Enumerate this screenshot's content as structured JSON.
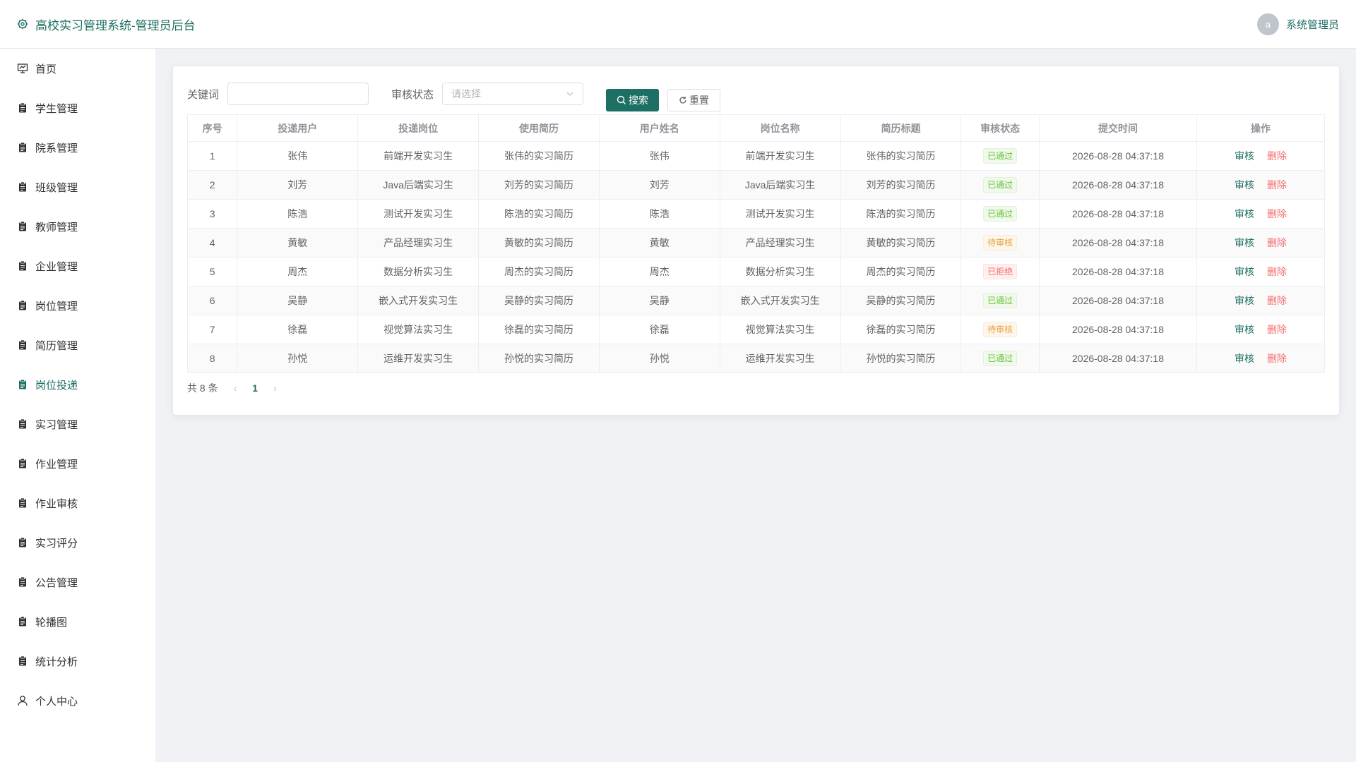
{
  "header": {
    "title": "高校实习管理系统-管理员后台",
    "avatar_text": "a",
    "username": "系统管理员"
  },
  "sidebar": {
    "items": [
      {
        "label": "首页",
        "icon": "dashboard-icon",
        "active": false
      },
      {
        "label": "学生管理",
        "icon": "clipboard-icon",
        "active": false
      },
      {
        "label": "院系管理",
        "icon": "clipboard-icon",
        "active": false
      },
      {
        "label": "班级管理",
        "icon": "clipboard-icon",
        "active": false
      },
      {
        "label": "教师管理",
        "icon": "clipboard-icon",
        "active": false
      },
      {
        "label": "企业管理",
        "icon": "clipboard-icon",
        "active": false
      },
      {
        "label": "岗位管理",
        "icon": "clipboard-icon",
        "active": false
      },
      {
        "label": "简历管理",
        "icon": "clipboard-icon",
        "active": false
      },
      {
        "label": "岗位投递",
        "icon": "clipboard-icon",
        "active": true
      },
      {
        "label": "实习管理",
        "icon": "clipboard-icon",
        "active": false
      },
      {
        "label": "作业管理",
        "icon": "clipboard-icon",
        "active": false
      },
      {
        "label": "作业审核",
        "icon": "clipboard-icon",
        "active": false
      },
      {
        "label": "实习评分",
        "icon": "clipboard-icon",
        "active": false
      },
      {
        "label": "公告管理",
        "icon": "clipboard-icon",
        "active": false
      },
      {
        "label": "轮播图",
        "icon": "clipboard-icon",
        "active": false
      },
      {
        "label": "统计分析",
        "icon": "clipboard-icon",
        "active": false
      },
      {
        "label": "个人中心",
        "icon": "user-icon",
        "active": false
      }
    ]
  },
  "filters": {
    "keyword_label": "关键词",
    "keyword_value": "",
    "status_label": "审核状态",
    "status_placeholder": "请选择",
    "search_label": "搜索",
    "reset_label": "重置"
  },
  "table": {
    "columns": [
      "序号",
      "投递用户",
      "投递岗位",
      "使用简历",
      "用户姓名",
      "岗位名称",
      "简历标题",
      "审核状态",
      "提交时间",
      "操作"
    ],
    "rows": [
      {
        "no": "1",
        "user": "张伟",
        "job": "前端开发实习生",
        "resume": "张伟的实习简历",
        "name": "张伟",
        "position": "前端开发实习生",
        "title": "张伟的实习简历",
        "status": "已通过",
        "status_type": "success",
        "time": "2026-08-28 04:37:18"
      },
      {
        "no": "2",
        "user": "刘芳",
        "job": "Java后端实习生",
        "resume": "刘芳的实习简历",
        "name": "刘芳",
        "position": "Java后端实习生",
        "title": "刘芳的实习简历",
        "status": "已通过",
        "status_type": "success",
        "time": "2026-08-28 04:37:18"
      },
      {
        "no": "3",
        "user": "陈浩",
        "job": "测试开发实习生",
        "resume": "陈浩的实习简历",
        "name": "陈浩",
        "position": "测试开发实习生",
        "title": "陈浩的实习简历",
        "status": "已通过",
        "status_type": "success",
        "time": "2026-08-28 04:37:18"
      },
      {
        "no": "4",
        "user": "黄敏",
        "job": "产品经理实习生",
        "resume": "黄敏的实习简历",
        "name": "黄敏",
        "position": "产品经理实习生",
        "title": "黄敏的实习简历",
        "status": "待审核",
        "status_type": "warning",
        "time": "2026-08-28 04:37:18"
      },
      {
        "no": "5",
        "user": "周杰",
        "job": "数据分析实习生",
        "resume": "周杰的实习简历",
        "name": "周杰",
        "position": "数据分析实习生",
        "title": "周杰的实习简历",
        "status": "已拒绝",
        "status_type": "danger",
        "time": "2026-08-28 04:37:18"
      },
      {
        "no": "6",
        "user": "吴静",
        "job": "嵌入式开发实习生",
        "resume": "吴静的实习简历",
        "name": "吴静",
        "position": "嵌入式开发实习生",
        "title": "吴静的实习简历",
        "status": "已通过",
        "status_type": "success",
        "time": "2026-08-28 04:37:18"
      },
      {
        "no": "7",
        "user": "徐磊",
        "job": "视觉算法实习生",
        "resume": "徐磊的实习简历",
        "name": "徐磊",
        "position": "视觉算法实习生",
        "title": "徐磊的实习简历",
        "status": "待审核",
        "status_type": "warning",
        "time": "2026-08-28 04:37:18"
      },
      {
        "no": "8",
        "user": "孙悦",
        "job": "运维开发实习生",
        "resume": "孙悦的实习简历",
        "name": "孙悦",
        "position": "运维开发实习生",
        "title": "孙悦的实习简历",
        "status": "已通过",
        "status_type": "success",
        "time": "2026-08-28 04:37:18"
      }
    ],
    "actions": {
      "audit": "审核",
      "delete": "删除"
    }
  },
  "pagination": {
    "total_text": "共 8 条",
    "current_page": "1"
  },
  "colors": {
    "accent": "#1d6e63",
    "danger": "#f56c6c"
  }
}
